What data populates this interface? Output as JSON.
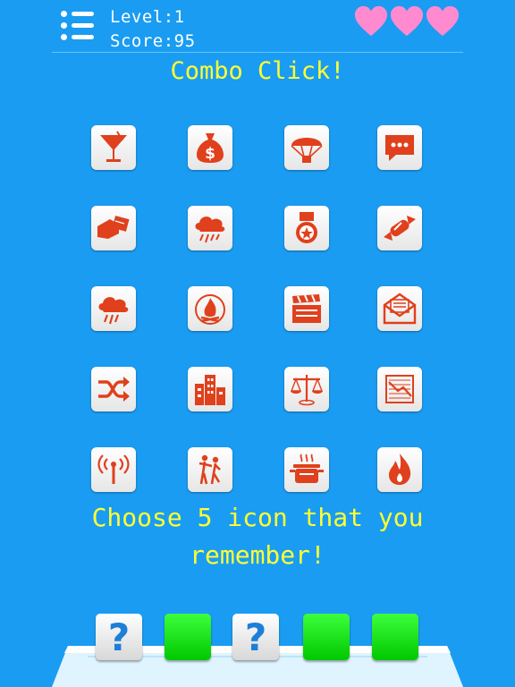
{
  "hud": {
    "level_text": "Level:1",
    "score_text": "Score:95",
    "lives": 3
  },
  "title": "Combo Click!",
  "grid_icons": [
    "cocktail-icon",
    "money-bag-icon",
    "parachute-icon",
    "chat-bubble-icon",
    "handshake-card-icon",
    "rain-cloud-icon",
    "medal-icon",
    "candy-icon",
    "storm-cloud-icon",
    "campfire-icon",
    "clapperboard-icon",
    "envelope-letter-icon",
    "shuffle-icon",
    "city-buildings-icon",
    "scales-icon",
    "chart-document-icon",
    "wireless-signal-icon",
    "dancing-couple-icon",
    "cooking-pot-icon",
    "fire-icon"
  ],
  "instruction": {
    "line1": "Choose 5 icon that you",
    "line2": "remember!"
  },
  "answer_slots": [
    {
      "state": "unknown",
      "label": "?"
    },
    {
      "state": "filled",
      "label": ""
    },
    {
      "state": "unknown",
      "label": "?"
    },
    {
      "state": "filled",
      "label": ""
    },
    {
      "state": "filled",
      "label": ""
    }
  ],
  "colors": {
    "background": "#1a9cf2",
    "accent_text": "#ffff33",
    "icon": "#e0401c",
    "heart": "#ff8ad0",
    "slot_filled": "#00d800"
  }
}
